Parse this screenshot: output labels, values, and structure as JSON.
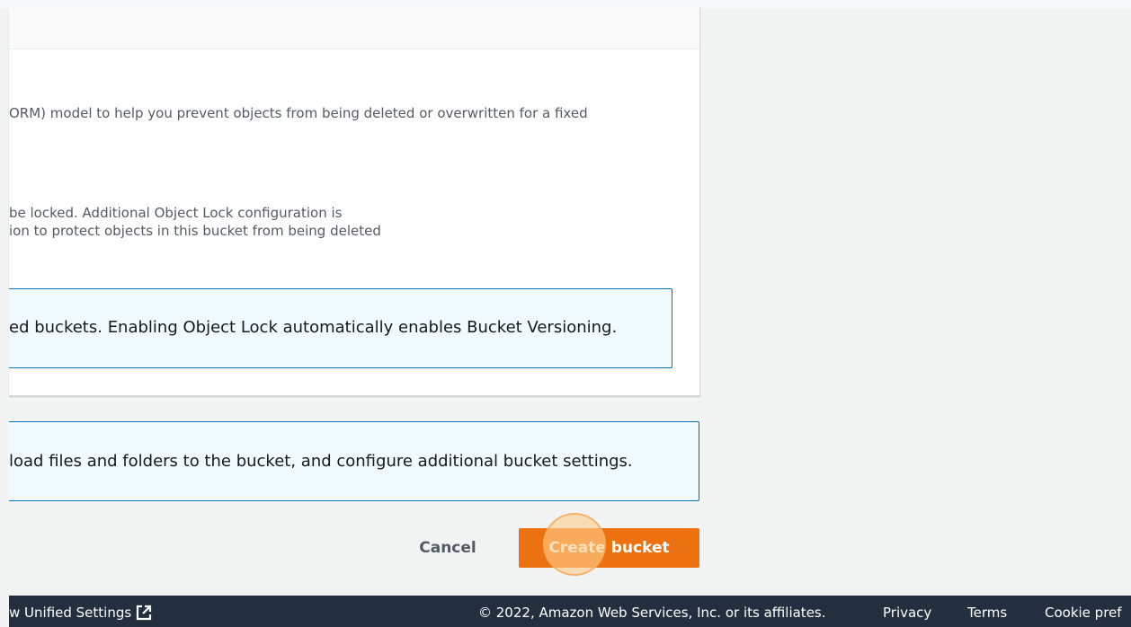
{
  "object_lock": {
    "description": "ORM) model to help you prevent objects from being deleted or overwritten for a fixed",
    "checkbox_description_line1": "be locked. Additional Object Lock configuration is",
    "checkbox_description_line2": "ion to protect objects in this bucket from being deleted",
    "info_alert": "ed buckets. Enabling Object Lock automatically enables Bucket Versioning."
  },
  "next_steps_alert": "load files and folders to the bucket, and configure additional bucket settings.",
  "actions": {
    "cancel_label": "Cancel",
    "create_label": "Create bucket"
  },
  "footer": {
    "feedback_label": "w Unified Settings",
    "copyright": "© 2022, Amazon Web Services, Inc. or its affiliates.",
    "privacy": "Privacy",
    "terms": "Terms",
    "cookie": "Cookie pref"
  },
  "colors": {
    "primary_button": "#ec7211",
    "info_border": "#0073bb",
    "info_background": "#f1faff",
    "footer_background": "#232f3e"
  }
}
